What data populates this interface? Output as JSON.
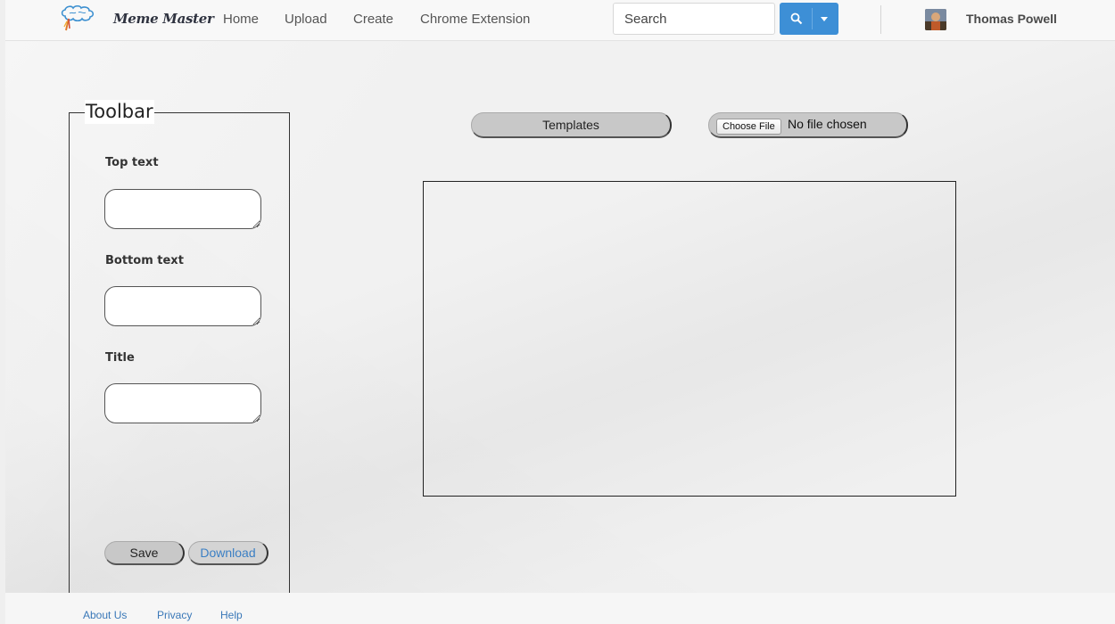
{
  "navbar": {
    "brand": "Meme Master",
    "links": [
      "Home",
      "Upload",
      "Create",
      "Chrome Extension"
    ],
    "search": {
      "placeholder": "Search"
    },
    "user": {
      "name": "Thomas Powell"
    },
    "accent_color": "#3d8fd6"
  },
  "toolbar": {
    "legend": "Toolbar",
    "fields": [
      {
        "label": "Top text",
        "value": ""
      },
      {
        "label": "Bottom text",
        "value": ""
      },
      {
        "label": "Title",
        "value": ""
      }
    ],
    "save_label": "Save",
    "download_label": "Download"
  },
  "main": {
    "templates_label": "Templates",
    "file": {
      "button_label": "Choose File",
      "status": "No file chosen"
    }
  },
  "footer": {
    "links": [
      "About Us",
      "Privacy",
      "Help"
    ]
  }
}
